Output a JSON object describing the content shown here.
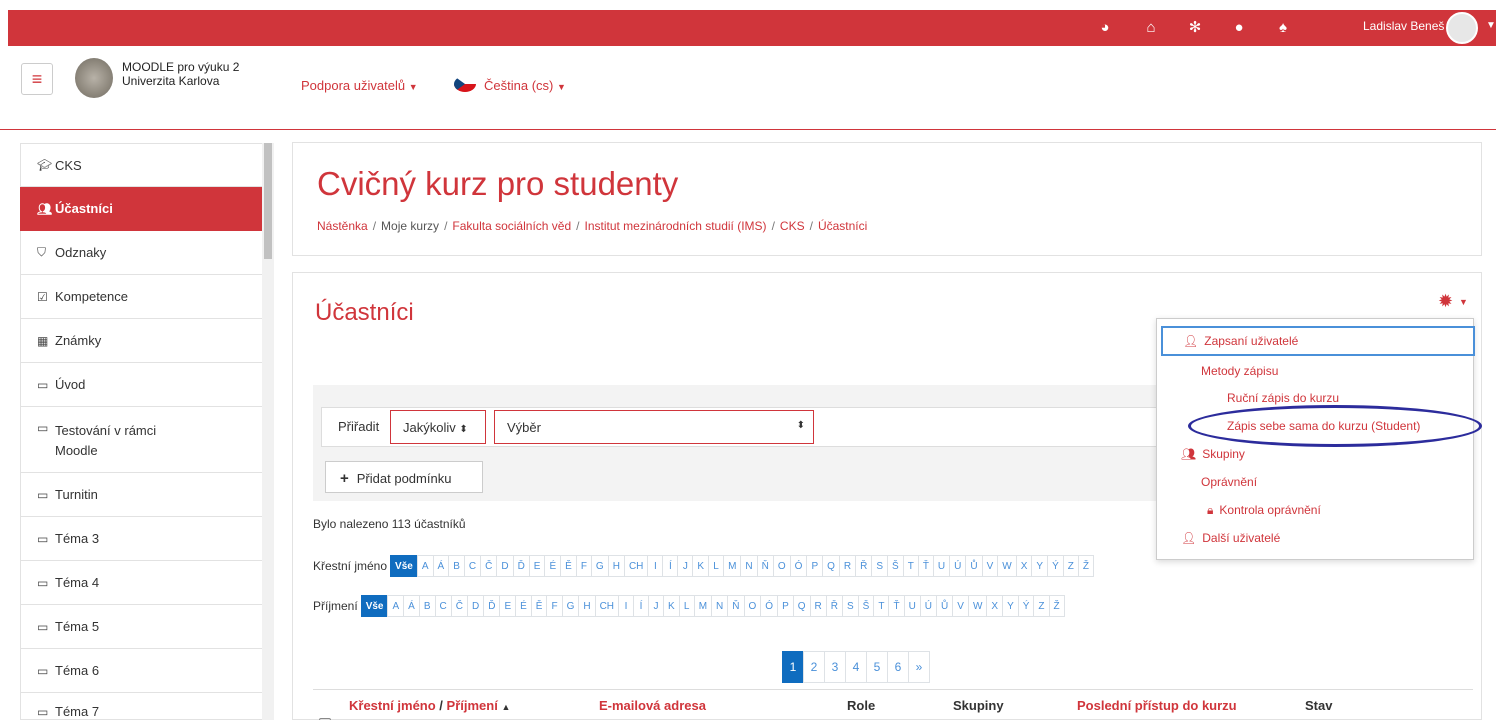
{
  "topbar": {
    "icons": [
      "dashboard-icon",
      "home-icon",
      "network-icon",
      "chat-icon",
      "bell-icon"
    ],
    "username": "Ladislav Beneš"
  },
  "header": {
    "site_name_line1": "MOODLE pro výuku 2",
    "site_name_line2": "Univerzita Karlova",
    "support_link": "Podpora uživatelů",
    "language": "Čeština (cs)"
  },
  "sidebar": {
    "items": [
      {
        "label": "CKS",
        "icon": "graduation-cap-icon",
        "active": false
      },
      {
        "label": "Účastníci",
        "icon": "users-icon",
        "active": true
      },
      {
        "label": "Odznaky",
        "icon": "shield-icon",
        "active": false
      },
      {
        "label": "Kompetence",
        "icon": "checkbox-icon",
        "active": false
      },
      {
        "label": "Známky",
        "icon": "table-icon",
        "active": false
      },
      {
        "label": "Úvod",
        "icon": "folder-icon",
        "active": false
      },
      {
        "label": "Testování v rámci Moodle",
        "icon": "folder-icon",
        "active": false
      },
      {
        "label": "Turnitin",
        "icon": "folder-icon",
        "active": false
      },
      {
        "label": "Téma 3",
        "icon": "folder-icon",
        "active": false
      },
      {
        "label": "Téma 4",
        "icon": "folder-icon",
        "active": false
      },
      {
        "label": "Téma 5",
        "icon": "folder-icon",
        "active": false
      },
      {
        "label": "Téma 6",
        "icon": "folder-icon",
        "active": false
      },
      {
        "label": "Téma 7",
        "icon": "folder-icon",
        "active": false
      }
    ]
  },
  "course": {
    "title": "Cvičný kurz pro studenty",
    "breadcrumb": [
      "Nástěnka",
      "Moje kurzy",
      "Fakulta sociálních věd",
      "Institut mezinárodních studií (IMS)",
      "CKS",
      "Účastníci"
    ]
  },
  "participants": {
    "title": "Účastníci",
    "assign_label": "Přiřadit",
    "match_select": "Jakýkoliv",
    "filter_select": "Výběr",
    "add_condition": "Přidat podmínku",
    "found_text": "Bylo nalezeno 113 účastníků",
    "first_name_label": "Křestní jméno",
    "last_name_label": "Příjmení",
    "letters": [
      "Vše",
      "A",
      "Á",
      "B",
      "C",
      "Č",
      "D",
      "Ď",
      "E",
      "É",
      "Ě",
      "F",
      "G",
      "H",
      "CH",
      "I",
      "Í",
      "J",
      "K",
      "L",
      "M",
      "N",
      "Ň",
      "O",
      "Ó",
      "P",
      "Q",
      "R",
      "Ř",
      "S",
      "Š",
      "T",
      "Ť",
      "U",
      "Ú",
      "Ů",
      "V",
      "W",
      "X",
      "Y",
      "Ý",
      "Z",
      "Ž"
    ],
    "pages": [
      "1",
      "2",
      "3",
      "4",
      "5",
      "6",
      "»"
    ],
    "current_page": "1",
    "table_headers": {
      "name_first": "Křestní jméno",
      "name_sep": " / ",
      "name_last": "Příjmení",
      "sort_indicator": "▲",
      "email": "E-mailová adresa",
      "role": "Role",
      "groups": "Skupiny",
      "last_access": "Poslední přístup do kurzu",
      "status": "Stav"
    }
  },
  "dropdown": {
    "items": [
      {
        "label": "Zapsaní uživatelé",
        "icon": "user-plus-icon"
      },
      {
        "label": "Metody zápisu",
        "icon": ""
      },
      {
        "label": "Ruční zápis do kurzu",
        "icon": ""
      },
      {
        "label": "Zápis sebe sama do kurzu (Student)",
        "icon": ""
      },
      {
        "label": "Skupiny",
        "icon": "users-icon"
      },
      {
        "label": "Oprávnění",
        "icon": ""
      },
      {
        "label": "Kontrola oprávnění",
        "icon": "lock-icon"
      },
      {
        "label": "Další uživatelé",
        "icon": "user-plus-icon"
      }
    ]
  },
  "colors": {
    "brand_red": "#d0353b",
    "link_blue": "#0f6cbf",
    "highlight_oval": "#2c2c9c"
  }
}
